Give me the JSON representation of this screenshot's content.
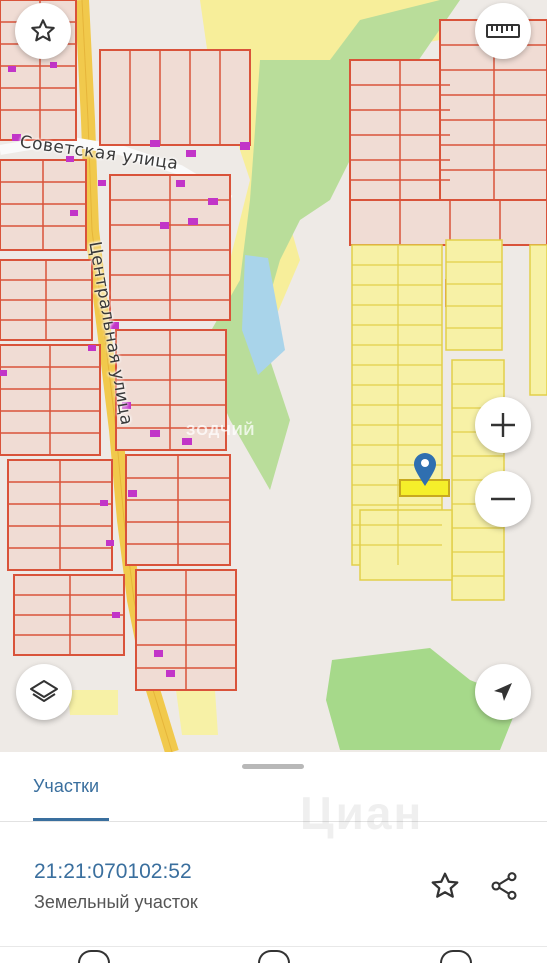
{
  "map": {
    "streets": {
      "sovetskaya": "Советская улица",
      "tsentralnaya": "Центральная улица"
    },
    "watermark": "ЗОДЧИЙ",
    "buttons": {
      "favorite": "star-icon",
      "ruler": "ruler-icon",
      "zoom_in": "plus-icon",
      "zoom_out": "minus-icon",
      "layers": "layers-icon",
      "locate": "navigation-arrow-icon"
    },
    "colors": {
      "parcel_border": "#d9533a",
      "parcel_fill": "#f0dcd4",
      "yellow_parcel": "#f7f1a6",
      "green": "#a5d98a",
      "water": "#a9d4ea",
      "road": "#f1c94c",
      "marker": "#2f6fb0"
    }
  },
  "sheet": {
    "tab_label": "Участки",
    "parcel_id": "21:21:070102:52",
    "parcel_type": "Земельный участок",
    "watermark": "Циан",
    "accent": "#3a6f9e"
  }
}
